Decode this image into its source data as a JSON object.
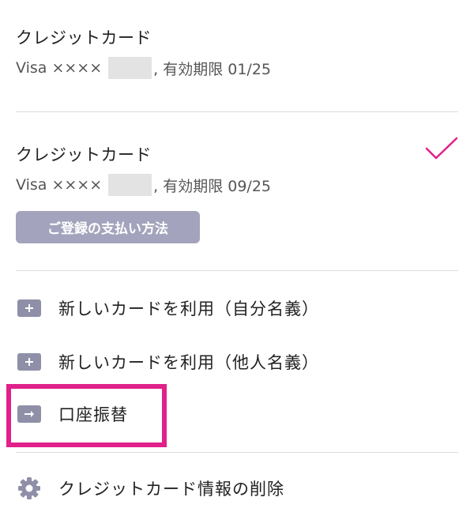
{
  "cards": [
    {
      "title": "クレジットカード",
      "number_prefix": "Visa ××××",
      "expiry": ", 有効期限 01/25",
      "selected": false
    },
    {
      "title": "クレジットカード",
      "number_prefix": "Visa ××××",
      "expiry": ", 有効期限 09/25",
      "selected": true,
      "badge": "ご登録の支払い方法"
    }
  ],
  "actions": {
    "new_card_self": "新しいカードを利用（自分名義）",
    "new_card_other": "新しいカードを利用（他人名義）",
    "bank_transfer": "口座振替",
    "delete_card_info": "クレジットカード情報の削除"
  },
  "colors": {
    "accent": "#e0218a",
    "badge_bg": "#a3a3bd",
    "icon_bg": "#8f8fa8",
    "divider": "#dddddd"
  },
  "icons": {
    "plus": "plus-icon",
    "arrow": "arrow-right-icon",
    "gear": "gear-icon",
    "check": "check-icon"
  }
}
